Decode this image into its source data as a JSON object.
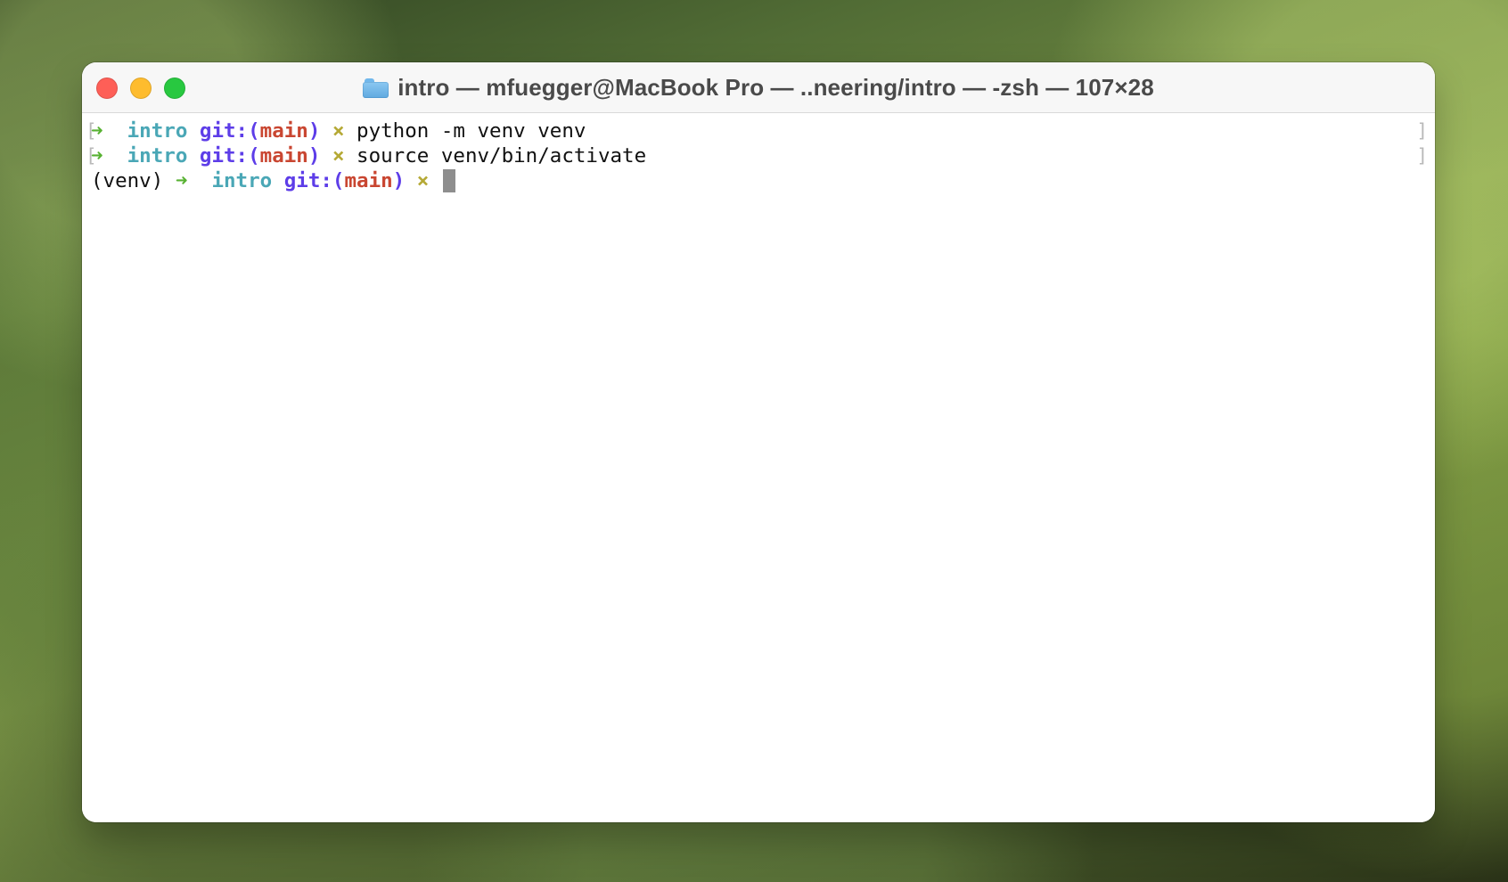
{
  "window": {
    "title": "intro — mfuegger@MacBook Pro — ..neering/intro — -zsh — 107×28",
    "folder_icon": "folder-icon"
  },
  "window_controls": {
    "close_icon": "close-icon",
    "minimize_icon": "minimize-icon",
    "zoom_icon": "zoom-icon"
  },
  "terminal": {
    "lines": [
      {
        "left_marker": "[",
        "arrow": "➜",
        "directory": "intro",
        "git_prefix": "git:(",
        "branch": "main",
        "git_suffix": ")",
        "dirty_marker": "×",
        "command": "python -m venv venv",
        "right_marker": "]"
      },
      {
        "left_marker": "[",
        "arrow": "➜",
        "directory": "intro",
        "git_prefix": "git:(",
        "branch": "main",
        "git_suffix": ")",
        "dirty_marker": "×",
        "command": "source venv/bin/activate",
        "right_marker": "]"
      },
      {
        "venv": "(venv)",
        "arrow": "➜",
        "directory": "intro",
        "git_prefix": "git:(",
        "branch": "main",
        "git_suffix": ")",
        "dirty_marker": "×"
      }
    ]
  },
  "colors": {
    "arrow": "#58b233",
    "directory": "#4aa7b6",
    "git": "#5d3de8",
    "branch": "#c94631",
    "dirty_marker": "#b5a935",
    "cursor": "#8e8e8e"
  }
}
